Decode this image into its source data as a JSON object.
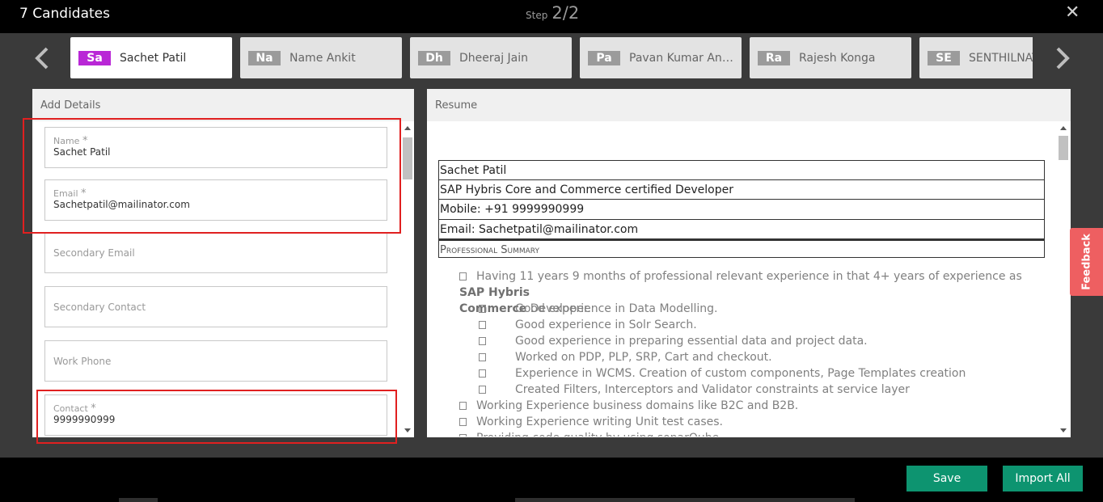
{
  "header": {
    "title": "7 Candidates",
    "step_label": "Step",
    "step_value": "2/2"
  },
  "candidates": [
    {
      "initials": "Sa",
      "name": "Sachet Patil",
      "active": true
    },
    {
      "initials": "Na",
      "name": "Name Ankit",
      "active": false
    },
    {
      "initials": "Dh",
      "name": "Dheeraj Jain",
      "active": false
    },
    {
      "initials": "Pa",
      "name": "Pavan Kumar Anu...",
      "active": false
    },
    {
      "initials": "Ra",
      "name": "Rajesh Konga",
      "active": false
    },
    {
      "initials": "SE",
      "name": "SENTHILNATHAN",
      "active": false
    }
  ],
  "details": {
    "title": "Add Details",
    "fields": {
      "name": {
        "label": "Name",
        "required": "*",
        "value": "Sachet Patil"
      },
      "email": {
        "label": "Email",
        "required": "*",
        "value": "Sachetpatil@mailinator.com"
      },
      "secondary_email": {
        "placeholder": "Secondary Email"
      },
      "secondary_contact": {
        "placeholder": "Secondary Contact"
      },
      "work_phone": {
        "placeholder": "Work Phone"
      },
      "contact": {
        "label": "Contact",
        "required": "*",
        "value": "9999990999"
      }
    }
  },
  "resume": {
    "title": "Resume",
    "table_rows": [
      "Sachet Patil",
      "SAP Hybris Core and Commerce certified Developer",
      "Mobile: +91 9999990999",
      "Email: Sachetpatil@mailinator.com"
    ],
    "summary_heading": "Professional Summary",
    "bullet_1_prefix": "Having 11 years 9 months of professional relevant experience in that 4+ years of experience as ",
    "bullet_1_bold_a": "SAP Hybris",
    "bullet_1_bold_b": "Commerce",
    "bullet_1_suffix": " Developer.",
    "sub_bullets": [
      "Good experience in Data Modelling.",
      "Good experience in Solr Search.",
      "Good experience in preparing essential data and project data.",
      "Worked on PDP, PLP, SRP, Cart and checkout.",
      "Experience in WCMS. Creation of custom components, Page Templates creation",
      "Created Filters, Interceptors and Validator constraints at service layer"
    ],
    "bullets_after": [
      "Working Experience business domains like B2C and B2B.",
      "Working Experience writing Unit test cases.",
      "Providing code quality by using sonarQube."
    ]
  },
  "feedback_label": "Feedback",
  "footer": {
    "save_label": "Save",
    "import_label": "Import All"
  },
  "colors": {
    "accent": "#0d9470",
    "active_badge": "#b927d6",
    "highlight": "#e02020",
    "feedback": "#ee5f61"
  },
  "icons": {
    "close": "close-icon",
    "prev": "chevron-left-icon",
    "next": "chevron-right-icon"
  }
}
